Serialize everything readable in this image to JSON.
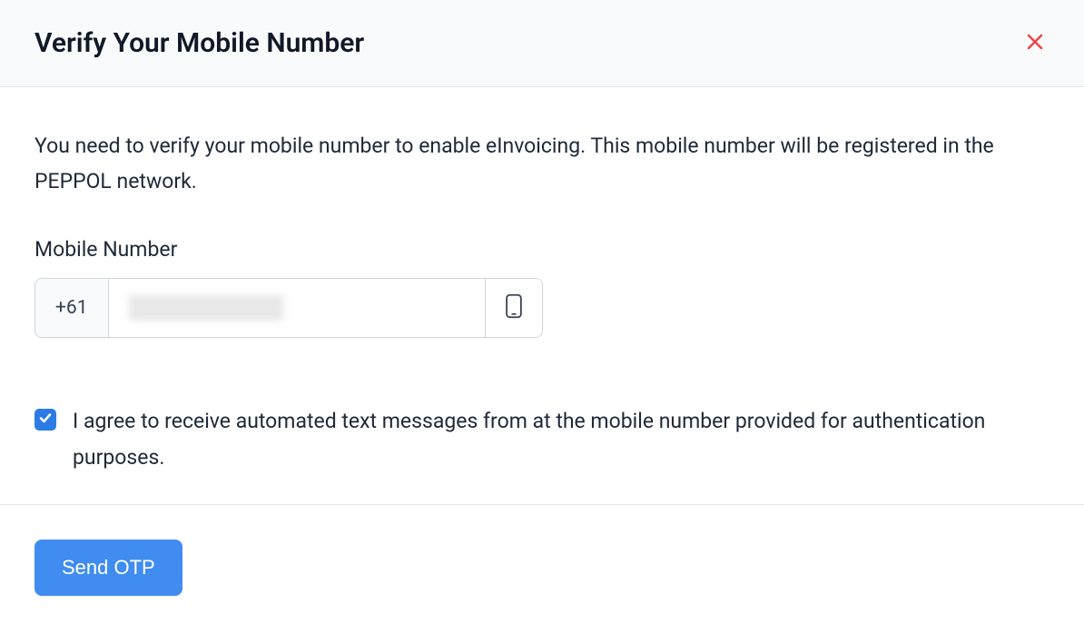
{
  "header": {
    "title": "Verify Your Mobile Number"
  },
  "body": {
    "description": "You need to verify your mobile number to enable eInvoicing. This mobile number will be registered in the PEPPOL network.",
    "mobile_label": "Mobile Number",
    "country_code": "+61",
    "phone_value": ""
  },
  "consent": {
    "checked": true,
    "text": "I agree to receive automated text messages from at the mobile number provided for authentication purposes."
  },
  "footer": {
    "send_label": "Send OTP"
  }
}
